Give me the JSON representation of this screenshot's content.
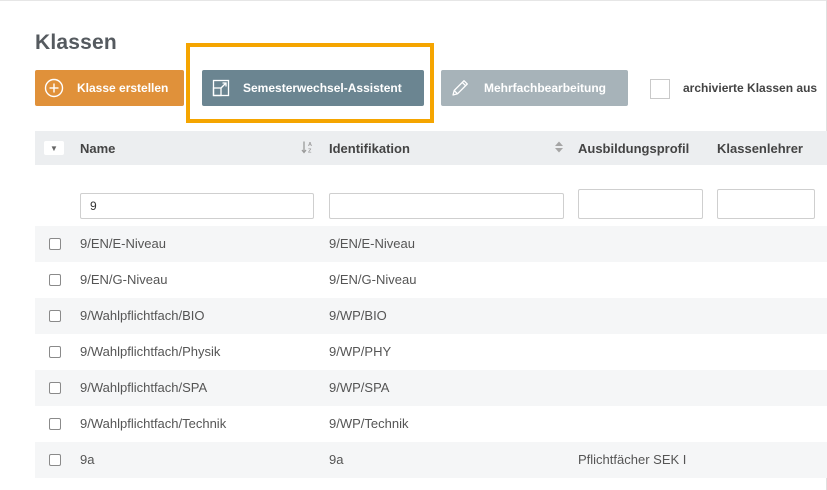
{
  "page": {
    "title": "Klassen"
  },
  "toolbar": {
    "create_label": "Klasse erstellen",
    "create_icon": "plus-circle-icon",
    "semester_label": "Semesterwechsel-Assistent",
    "semester_icon": "external-link-icon",
    "multi_label": "Mehrfachbearbeitung",
    "multi_icon": "pencil-icon",
    "archive_label": "archivierte Klassen aus"
  },
  "colors": {
    "create_button": "#e0913a",
    "semester_button": "#6b8591",
    "multi_button": "#a7b3b9",
    "highlight": "#f5a500",
    "header_bg": "#eceef0",
    "row_alt_bg": "#f5f6f7"
  },
  "table": {
    "columns": [
      "Name",
      "Identifikation",
      "Ausbildungsprofil",
      "Klassenlehrer"
    ],
    "filters": {
      "name": "9",
      "identifikation": "",
      "ausbildungsprofil": "",
      "klassenlehrer": ""
    },
    "rows": [
      {
        "name": "9/EN/E-Niveau",
        "identifikation": "9/EN/E-Niveau",
        "ausbildungsprofil": ""
      },
      {
        "name": "9/EN/G-Niveau",
        "identifikation": "9/EN/G-Niveau",
        "ausbildungsprofil": ""
      },
      {
        "name": "9/Wahlpflichtfach/BIO",
        "identifikation": "9/WP/BIO",
        "ausbildungsprofil": ""
      },
      {
        "name": "9/Wahlpflichtfach/Physik",
        "identifikation": "9/WP/PHY",
        "ausbildungsprofil": ""
      },
      {
        "name": "9/Wahlpflichtfach/SPA",
        "identifikation": "9/WP/SPA",
        "ausbildungsprofil": ""
      },
      {
        "name": "9/Wahlpflichtfach/Technik",
        "identifikation": "9/WP/Technik",
        "ausbildungsprofil": ""
      },
      {
        "name": "9a",
        "identifikation": "9a",
        "ausbildungsprofil": "Pflichtfächer SEK I"
      }
    ]
  }
}
